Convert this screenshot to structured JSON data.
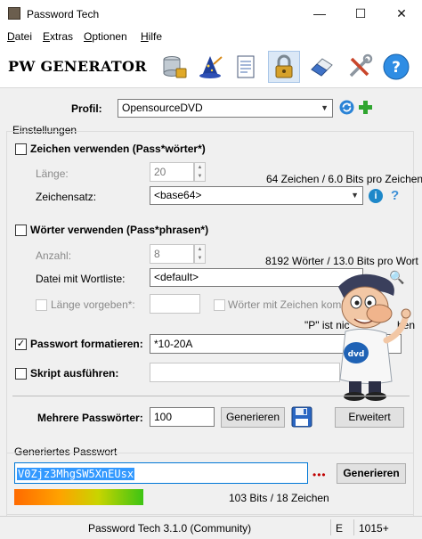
{
  "window": {
    "title": "Password Tech",
    "minimize_glyph": "—",
    "maximize_glyph": "☐",
    "close_glyph": "✕"
  },
  "menu": [
    "Datei",
    "Extras",
    "Optionen",
    "Hilfe"
  ],
  "toolbar": {
    "heading": "PW GENERATOR",
    "icons": [
      "database-lock-icon",
      "wizard-hat-icon",
      "document-icon",
      "padlock-icon",
      "eraser-icon",
      "tools-icon",
      "help-icon"
    ]
  },
  "profile": {
    "label": "Profil:",
    "value": "OpensourceDVD"
  },
  "settings": {
    "title": "Einstellungen",
    "chars": {
      "label": "Zeichen verwenden (Pass*wörter*)",
      "length_label": "Länge:",
      "length_value": "20",
      "info": "64 Zeichen / 6.0 Bits pro Zeichen",
      "charset_label": "Zeichensatz:",
      "charset_value": "<base64>"
    },
    "words": {
      "label": "Wörter verwenden (Pass*phrasen*)",
      "count_label": "Anzahl:",
      "count_value": "8",
      "info": "8192 Wörter / 13.0 Bits pro Wort",
      "file_label": "Datei mit Wortliste:",
      "file_value": "<default>",
      "length_label": "Länge vorgeben*:",
      "combine_label": "Wörter mit Zeichen kombi",
      "note_text": "\"P\" ist nic",
      "note_suffix": "ben"
    },
    "format": {
      "label": "Passwort formatieren:",
      "value": "*10-20A"
    },
    "script": {
      "label": "Skript ausführen:"
    },
    "multiple": {
      "label": "Mehrere Passwörter:",
      "value": "100",
      "generate_label": "Generieren",
      "advanced_label": "Erweitert"
    }
  },
  "generated": {
    "title": "Generiertes Passwort",
    "password": "V0Zjz3MhgSW5XnEUsx",
    "dots": "•••",
    "generate_label": "Generieren",
    "strength_fraction": 0.44,
    "info": "103 Bits / 18 Zeichen"
  },
  "status": {
    "version": "Password Tech 3.1.0 (Community)",
    "cell2": "E",
    "cell3": "1015+"
  },
  "colors": {
    "accent": "#0078d7",
    "selection": "#3399ff",
    "password_text": "#0645ad",
    "info_icon": "#1e88c9",
    "plus_icon": "#2fa52f",
    "dots": "#c00000"
  }
}
